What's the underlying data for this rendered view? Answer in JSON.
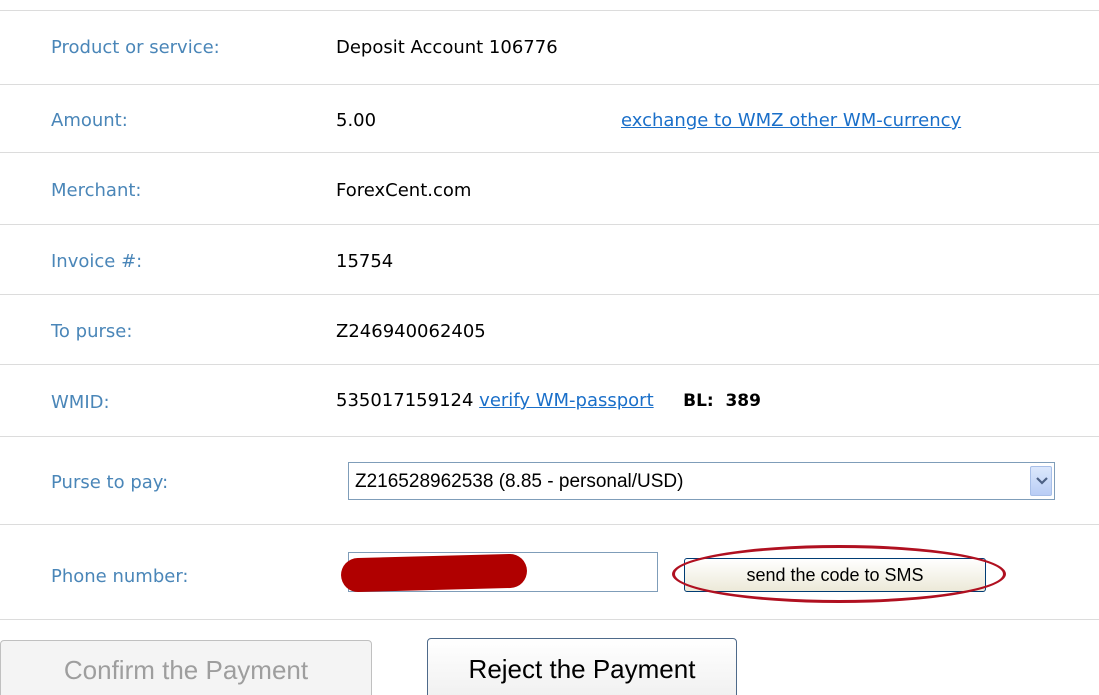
{
  "rows": {
    "product": {
      "label": "Product or service:",
      "value": "Deposit Account 106776"
    },
    "amount": {
      "label": "Amount:",
      "value": "5.00",
      "link": "exchange to WMZ other WM-currency"
    },
    "merchant": {
      "label": "Merchant:",
      "value": "ForexCent.com"
    },
    "invoice": {
      "label": "Invoice #:",
      "value": "15754"
    },
    "to_purse": {
      "label": "To purse:",
      "value": "Z246940062405"
    },
    "wmid": {
      "label": "WMID:",
      "value": "535017159124",
      "link": "verify WM-passport",
      "bl_label": "BL:",
      "bl_value": "389"
    },
    "purse_to_pay": {
      "label": "Purse to pay:",
      "selected": "Z216528962538 (8.85 - personal/USD)"
    },
    "phone": {
      "label": "Phone number:",
      "sms_button": "send the code to SMS"
    }
  },
  "buttons": {
    "confirm": "Confirm the Payment",
    "reject": "Reject the Payment"
  },
  "colors": {
    "label": "#4a86b8",
    "link": "#1a6fc9",
    "highlight_ellipse": "#b01020",
    "redaction": "#b00000"
  }
}
